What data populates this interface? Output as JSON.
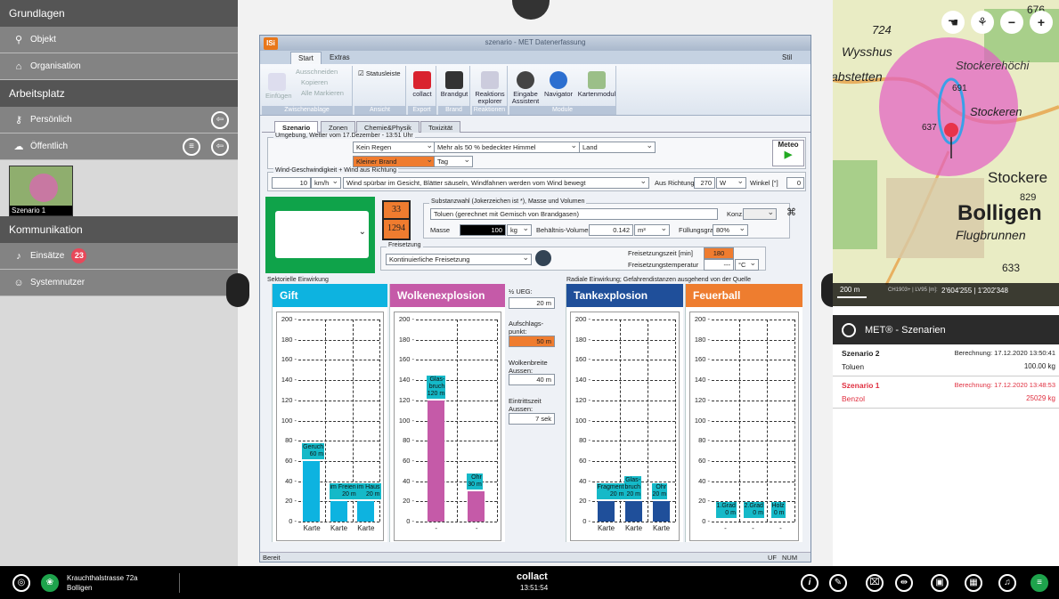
{
  "sidebar": {
    "sec_grundlagen": "Grundlagen",
    "objekt": "Objekt",
    "organisation": "Organisation",
    "sec_arbeitsplatz": "Arbeitsplatz",
    "persoenlich": "Persönlich",
    "oeffentlich": "Öffentlich",
    "scenario_thumb": "Szenario 1",
    "sec_kommunikation": "Kommunikation",
    "einsaetze": "Einsätze",
    "einsaetze_count": "23",
    "systemnutzer": "Systemnutzer"
  },
  "window": {
    "title": "szenario - MET Datenerfassung",
    "logo": "ISi",
    "tabs": {
      "start": "Start",
      "extras": "Extras",
      "stil": "Stil"
    },
    "ribbon": {
      "einfuegen": "Einfügen",
      "ausschneiden": "Ausschneiden",
      "kopieren": "Kopieren",
      "alle_markieren": "Alle Markieren",
      "g_zwischenablage": "Zwischenablage",
      "statusleiste": "Statusleiste",
      "g_ansicht": "Ansicht",
      "collact": "collact",
      "g_export": "Export",
      "brandgut": "Brandgut",
      "g_brand": "Brand",
      "reaktionsexplorer": "Reaktions explorer",
      "g_reaktionen": "Reaktionen",
      "eingabe": "Eingabe Assistent",
      "navigator": "Navigator",
      "kartenmodul": "Kartenmodul",
      "g_module": "Module"
    },
    "doc_tabs": [
      "Szenario",
      "Zonen",
      "Chemie&Physik",
      "Toxizität"
    ],
    "weather": {
      "legend": "Umgebung, Wetter vom 17.Dezember - 13:51 Uhr",
      "rain": "Kein Regen",
      "sky": "Mehr als 50 % bedeckter Himmel",
      "terrain": "Land",
      "fire": "Kleiner Brand",
      "day": "Tag",
      "meteo": "Meteo"
    },
    "wind": {
      "legend": "Wind-Geschwindigkeit + Wind aus Richtung",
      "speed": "10",
      "unit": "km/h",
      "desc": "Wind spürbar im Gesicht, Blätter säuseln, Windfahnen werden vom Wind bewegt",
      "dir_label": "Aus Richtung",
      "dir": "270",
      "dir_unit": "W",
      "angle_label": "Winkel [°]",
      "angle": "0"
    },
    "hazard": {
      "num_top": "33",
      "num_bottom": "1294"
    },
    "substance": {
      "legend": "Substanzwahl (Jokerzeichen ist *), Masse und Volumen",
      "name": "Toluen (gerechnet mit Gemisch von Brandgasen)",
      "konz": "Konz.",
      "masse_label": "Masse",
      "masse": "100",
      "masse_unit": "kg",
      "vol_label": "Behältnis-Volumen",
      "vol": "0.142",
      "vol_unit": "m³",
      "fill_label": "Füllungsgrad",
      "fill": "80%"
    },
    "release": {
      "legend": "Freisetzung",
      "type": "Kontinuierliche Freisetzung",
      "time_label": "Freisetzungszeit [min]",
      "time": "180",
      "temp_label": "Freisetzungstemperatur",
      "temp": "---",
      "temp_unit": "°C"
    },
    "sector_legend": "Sektorielle Einwirkung",
    "radial_legend": "Radiale Einwirkung;  Gefahrendistanzen ausgehend von der Quelle",
    "mid": {
      "ueg_label": "½ UEG:",
      "ueg": "20 m",
      "aufschlag_label": "Aufschlags-punkt:",
      "aufschlag": "50 m",
      "breite_label": "Wolkenbreite Aussen:",
      "breite": "40 m",
      "zeit_label": "Eintrittszeit Aussen:",
      "zeit": "7 sek"
    },
    "status": {
      "left": "Bereit",
      "uf": "UF",
      "num": "NUM"
    }
  },
  "chart_data": [
    {
      "type": "bar",
      "title": "Gift",
      "color": "#0db3e0",
      "ylim": [
        0,
        200
      ],
      "yticks": [
        0,
        20,
        40,
        60,
        80,
        100,
        120,
        140,
        160,
        180,
        200
      ],
      "categories": [
        "Karte",
        "Karte",
        "Karte"
      ],
      "values": [
        60,
        20,
        20
      ],
      "labels": [
        "Geruch\n60 m",
        "im Freien\n20 m",
        "im Haus\n20 m"
      ]
    },
    {
      "type": "bar",
      "title": "Wolkenexplosion",
      "color": "#c55aa8",
      "ylim": [
        0,
        200
      ],
      "yticks": [
        0,
        20,
        40,
        60,
        80,
        100,
        120,
        140,
        160,
        180,
        200
      ],
      "categories": [
        "-",
        "-"
      ],
      "values": [
        120,
        30
      ],
      "labels": [
        "Glas-\nbruch\n120 m",
        "Ohr\n30 m"
      ]
    },
    {
      "type": "bar",
      "title": "Tankexplosion",
      "color": "#1f4f9a",
      "ylim": [
        0,
        200
      ],
      "yticks": [
        0,
        20,
        40,
        60,
        80,
        100,
        120,
        140,
        160,
        180,
        200
      ],
      "categories": [
        "Karte",
        "Karte",
        "Karte"
      ],
      "values": [
        20,
        20,
        20
      ],
      "labels": [
        "Fragment\n20 m",
        "Glas-\nbruch\n20 m",
        "Ohr\n20 m"
      ]
    },
    {
      "type": "bar",
      "title": "Feuerball",
      "color": "#ee7d2f",
      "ylim": [
        0,
        200
      ],
      "yticks": [
        0,
        20,
        40,
        60,
        80,
        100,
        120,
        140,
        160,
        180,
        200
      ],
      "categories": [
        "-",
        "-",
        "-"
      ],
      "values": [
        0,
        0,
        0
      ],
      "labels": [
        "1.Grad\n0 m",
        "2.Grad\n0 m",
        "Holz\n0 m"
      ]
    }
  ],
  "map": {
    "labels": [
      "724",
      "Wysshus",
      "Stockerehöchi",
      "abstetten",
      "691",
      "Stockeren",
      "637",
      "Stockere",
      "829",
      "Bolligen",
      "Flugbrunnen",
      "633",
      "676"
    ],
    "scale": "200 m",
    "coords": "2'604'255 | 1'202'348",
    "coord_prefix": "CH1903+ | LV95 [m]:"
  },
  "scenarios": {
    "title": "MET® - Szenarien",
    "items": [
      {
        "name": "Szenario 2",
        "calc": "Berechnung: 17.12.2020 13:50:41",
        "substance": "Toluen",
        "mass": "100.00 kg",
        "active": false
      },
      {
        "name": "Szenario 1",
        "calc": "Berechnung: 17.12.2020 13:48:53",
        "substance": "Benzol",
        "mass": "25029 kg",
        "active": true
      }
    ]
  },
  "taskbar": {
    "address": "Krauchthalstrasse 72a",
    "city": "Bolligen",
    "brand": "collact",
    "time": "13:51:54"
  }
}
